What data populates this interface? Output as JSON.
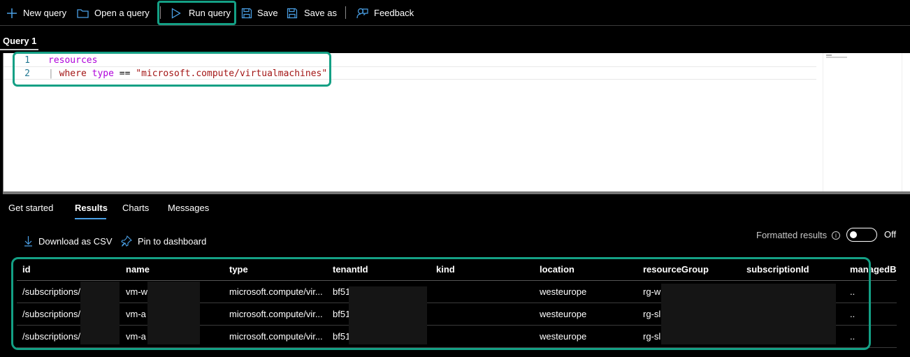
{
  "toolbar": {
    "new_query": "New query",
    "open_query": "Open a query",
    "run_query": "Run query",
    "save": "Save",
    "save_as": "Save as",
    "feedback": "Feedback"
  },
  "query_tab": {
    "label": "Query 1"
  },
  "editor": {
    "lines": [
      {
        "number": "1",
        "text": "resources"
      },
      {
        "number": "2",
        "pipe": "|",
        "keyword": "where",
        "field": "type",
        "operator": "==",
        "value": "\"microsoft.compute/virtualmachines\""
      }
    ]
  },
  "result_tabs": [
    "Get started",
    "Results",
    "Charts",
    "Messages"
  ],
  "active_result_tab": "Results",
  "results_toolbar": {
    "download_csv": "Download as CSV",
    "pin_dashboard": "Pin to dashboard",
    "formatted_results": "Formatted results",
    "toggle_state": "Off"
  },
  "table": {
    "columns": [
      "id",
      "name",
      "type",
      "tenantId",
      "kind",
      "location",
      "resourceGroup",
      "subscriptionId",
      "managedBy"
    ],
    "rows": [
      [
        "/subscriptions/",
        "vm-w",
        "microsoft.compute/vir...",
        "bf51",
        "",
        "westeurope",
        "rg-w",
        "",
        ".."
      ],
      [
        "/subscriptions/",
        "vm-a",
        "microsoft.compute/vir...",
        "bf51",
        "",
        "westeurope",
        "rg-sl",
        "",
        ".."
      ],
      [
        "/subscriptions/",
        "vm-a",
        "microsoft.compute/vir...",
        "bf51",
        "",
        "westeurope",
        "rg-sl",
        "",
        ".."
      ]
    ]
  },
  "colors": {
    "highlight": "#14a085",
    "accent_blue": "#4aa0e6",
    "background": "#000000"
  }
}
